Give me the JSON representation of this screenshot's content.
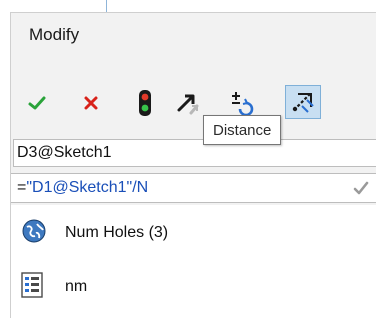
{
  "dialog": {
    "title": "Modify"
  },
  "toolbar": {
    "ok": "checkmark-icon",
    "cancel": "close-icon",
    "rebuild": "traffic-light-icon",
    "reset": "arrow-reset-icon",
    "increment": "plus-minus-spin-icon",
    "distance": "distance-measure-icon",
    "tooltip": "Distance"
  },
  "fields": {
    "dimension_name": "D3@Sketch1",
    "expression_prefix": "=",
    "expression_value": "\"D1@Sketch1\"/N"
  },
  "list": {
    "items": [
      {
        "label": "Num Holes (3)",
        "icon": "globe-variable-icon"
      },
      {
        "label": "nm",
        "icon": "list-table-icon"
      }
    ]
  },
  "colors": {
    "accent": "#1a4fb8",
    "ok_green": "#2aa33a",
    "cancel_red": "#d8221a",
    "highlight": "#c8dff2"
  }
}
